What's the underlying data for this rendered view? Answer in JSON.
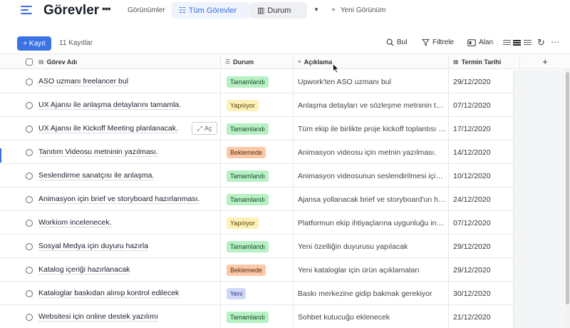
{
  "app": {
    "title": "Görevler",
    "more": "•••",
    "views_label": "Görünümler",
    "tabs": [
      {
        "label": "Tüm Görevler",
        "icon": "grid-view-icon",
        "active": true
      },
      {
        "label": "Durum",
        "icon": "kanban-view-icon",
        "active": false
      }
    ],
    "dropdown": "▼",
    "new_view_plus": "+",
    "new_view": "Yeni Görünüm"
  },
  "toolbar": {
    "add_label": "+ Kayıt",
    "record_count": "11 Kayıtlar",
    "search_label": "Bul",
    "filter_label": "Filtrele",
    "field_label": "Alan",
    "refresh": "↻",
    "more": "⋯"
  },
  "columns": {
    "name": "Görev Adı",
    "status": "Durum",
    "description": "Açıklama",
    "date": "Termin Tarihi",
    "add": "+"
  },
  "open_button": {
    "label": "Aç",
    "icon": "expand-icon"
  },
  "status_colors": {
    "Tamamlandı": {
      "bg": "#b7f0c4",
      "fg": "#1a4d2a"
    },
    "Yapılıyor": {
      "bg": "#fdf1b8",
      "fg": "#5a4400"
    },
    "Beklemede": {
      "bg": "#fbc9a8",
      "fg": "#5a2a0c"
    },
    "Yeni": {
      "bg": "#cfd9f7",
      "fg": "#27367a"
    }
  },
  "rows": [
    {
      "name": "ASO uzmanı freelancer bul",
      "status": "Tamamlandı",
      "description": "Upwork'ten ASO uzmanı bul",
      "date": "29/12/2020"
    },
    {
      "name": "UX Ajansı ile anlaşma detaylarını tamamla.",
      "status": "Yapılıyor",
      "description": "Anlaşma detayları ve sözleşme metninin tamamlanması",
      "date": "07/12/2020"
    },
    {
      "name": "UX Ajansı ile Kickoff Meeting planlanacak.",
      "status": "Tamamlandı",
      "description": "Tüm ekip ile birlikte proje kickoff toplantısı planlanacak",
      "date": "17/12/2020"
    },
    {
      "name": "Tanıtım Videosu metninin yazılması.",
      "status": "Beklemede",
      "description": "Animasyon videosu için metnin yazılması.",
      "date": "14/12/2020"
    },
    {
      "name": "Seslendirme sanatçısı ile anlaşma.",
      "status": "Tamamlandı",
      "description": "Animasyon videosunun seslendirilmesi için sanatçı",
      "date": "10/12/2020"
    },
    {
      "name": "Animasyon için brief ve storyboard hazırlanması.",
      "status": "Tamamlandı",
      "description": "Ajansa yollanacak brief ve storyboard'un hazırlanması",
      "date": "24/12/2020"
    },
    {
      "name": "Workiom incelenecek.",
      "status": "Yapılıyor",
      "description": "Platformun ekip ihtiyaçlarına uygunluğu incelenecek",
      "date": "07/12/2020"
    },
    {
      "name": "Sosyal Medya için duyuru hazırla",
      "status": "Tamamlandı",
      "description": "Yeni özelliğin duyurusu yapılacak",
      "date": "29/12/2020"
    },
    {
      "name": "Katalog içeriği hazırlanacak",
      "status": "Beklemede",
      "description": "Yeni kataloglar için ürün açıklamaları",
      "date": "29/12/2020"
    },
    {
      "name": "Kataloglar baskıdan alınıp kontrol edilecek",
      "status": "Yeni",
      "description": "Baskı merkezine gidip bakmak gerekiyor",
      "date": "30/12/2020"
    },
    {
      "name": "Websitesi için online destek yazılımı",
      "status": "Tamamlandı",
      "description": "Sohbet kutucuğu eklenecek",
      "date": "21/12/2020"
    }
  ]
}
